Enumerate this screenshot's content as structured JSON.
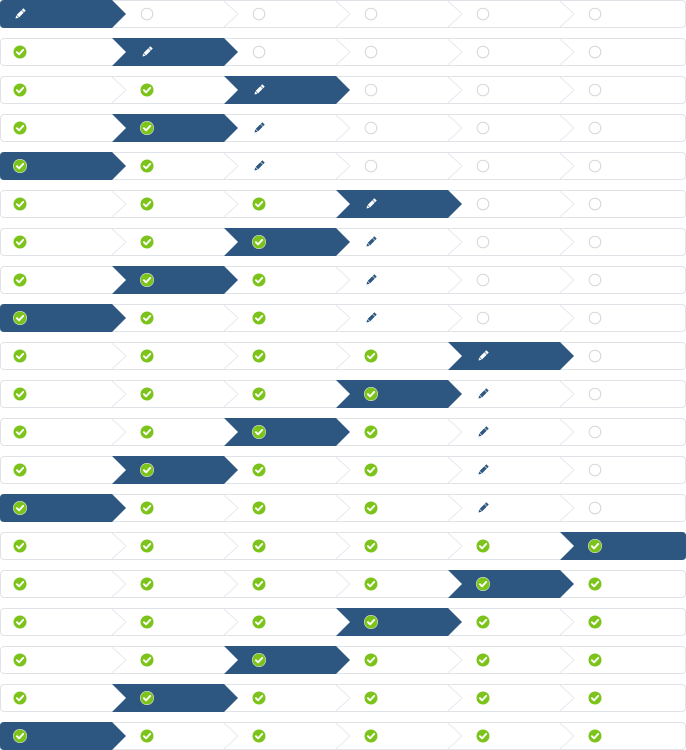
{
  "colors": {
    "active": "#2d5680",
    "complete": "#7cc41b",
    "pending_outline": "#d2d6db",
    "edit_icon": "#2d5680",
    "row_border": "#dfe3e8",
    "divider": "#e7eaee"
  },
  "icons": {
    "complete": "check-circle-icon",
    "current": "pencil-icon",
    "pending": "empty-circle-icon"
  },
  "wizard": {
    "step_count": 6,
    "rows": [
      {
        "active": 1,
        "states": [
          "current",
          "pending",
          "pending",
          "pending",
          "pending",
          "pending"
        ]
      },
      {
        "active": 2,
        "states": [
          "complete",
          "current",
          "pending",
          "pending",
          "pending",
          "pending"
        ]
      },
      {
        "active": 3,
        "states": [
          "complete",
          "complete",
          "current",
          "pending",
          "pending",
          "pending"
        ]
      },
      {
        "active": 2,
        "states": [
          "complete",
          "complete",
          "current",
          "pending",
          "pending",
          "pending"
        ]
      },
      {
        "active": 1,
        "states": [
          "complete",
          "complete",
          "current",
          "pending",
          "pending",
          "pending"
        ]
      },
      {
        "active": 4,
        "states": [
          "complete",
          "complete",
          "complete",
          "current",
          "pending",
          "pending"
        ]
      },
      {
        "active": 3,
        "states": [
          "complete",
          "complete",
          "complete",
          "current",
          "pending",
          "pending"
        ]
      },
      {
        "active": 2,
        "states": [
          "complete",
          "complete",
          "complete",
          "current",
          "pending",
          "pending"
        ]
      },
      {
        "active": 1,
        "states": [
          "complete",
          "complete",
          "complete",
          "current",
          "pending",
          "pending"
        ]
      },
      {
        "active": 5,
        "states": [
          "complete",
          "complete",
          "complete",
          "complete",
          "current",
          "pending"
        ]
      },
      {
        "active": 4,
        "states": [
          "complete",
          "complete",
          "complete",
          "complete",
          "current",
          "pending"
        ]
      },
      {
        "active": 3,
        "states": [
          "complete",
          "complete",
          "complete",
          "complete",
          "current",
          "pending"
        ]
      },
      {
        "active": 2,
        "states": [
          "complete",
          "complete",
          "complete",
          "complete",
          "current",
          "pending"
        ]
      },
      {
        "active": 1,
        "states": [
          "complete",
          "complete",
          "complete",
          "complete",
          "current",
          "pending"
        ]
      },
      {
        "active": 6,
        "states": [
          "complete",
          "complete",
          "complete",
          "complete",
          "complete",
          "complete"
        ]
      },
      {
        "active": 5,
        "states": [
          "complete",
          "complete",
          "complete",
          "complete",
          "complete",
          "complete"
        ]
      },
      {
        "active": 4,
        "states": [
          "complete",
          "complete",
          "complete",
          "complete",
          "complete",
          "complete"
        ]
      },
      {
        "active": 3,
        "states": [
          "complete",
          "complete",
          "complete",
          "complete",
          "complete",
          "complete"
        ]
      },
      {
        "active": 2,
        "states": [
          "complete",
          "complete",
          "complete",
          "complete",
          "complete",
          "complete"
        ]
      },
      {
        "active": 1,
        "states": [
          "complete",
          "complete",
          "complete",
          "complete",
          "complete",
          "complete"
        ]
      }
    ]
  }
}
